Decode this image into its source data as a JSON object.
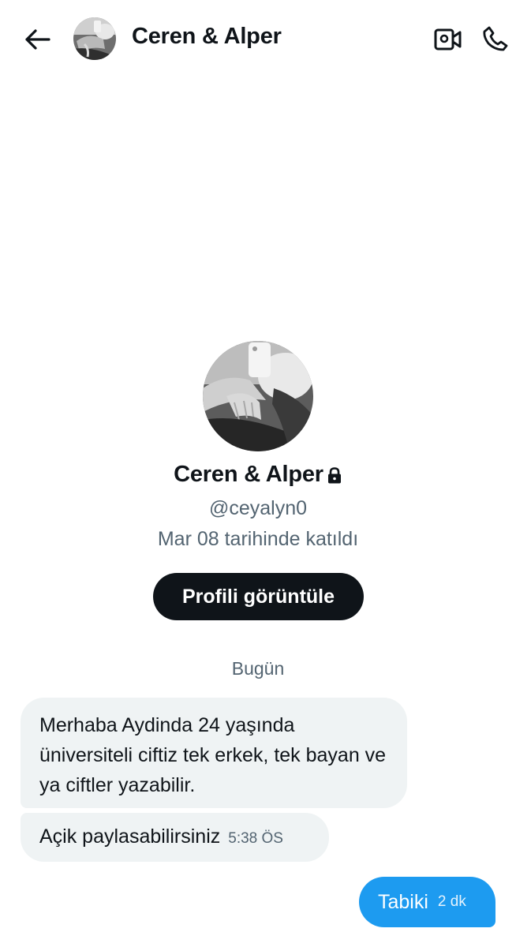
{
  "header": {
    "title": "Ceren & Alper",
    "back_icon": "arrow-left-icon",
    "video_icon": "video-camera-icon",
    "call_icon": "phone-icon"
  },
  "profile": {
    "name": "Ceren & Alper",
    "protected_icon": "lock-icon",
    "handle": "@ceyalyn0",
    "joined": "Mar 08 tarihinde katıldı",
    "view_button_label": "Profili görüntüle"
  },
  "day_separator": "Bugün",
  "messages": [
    {
      "direction": "incoming",
      "text": "Merhaba Aydinda 24 yaşında üniversiteli ciftiz tek erkek, tek bayan ve ya ciftler yazabilir.",
      "time": ""
    },
    {
      "direction": "incoming",
      "text": "Açik paylasabilirsiniz",
      "time": "5:38 ÖS"
    },
    {
      "direction": "outgoing",
      "text": "Tabiki",
      "time": "2 dk"
    }
  ],
  "colors": {
    "accent": "#1d9bf0",
    "text_primary": "#0f1419",
    "text_secondary": "#536471",
    "bubble_incoming": "#eff3f4",
    "button_dark": "#0f1419"
  }
}
